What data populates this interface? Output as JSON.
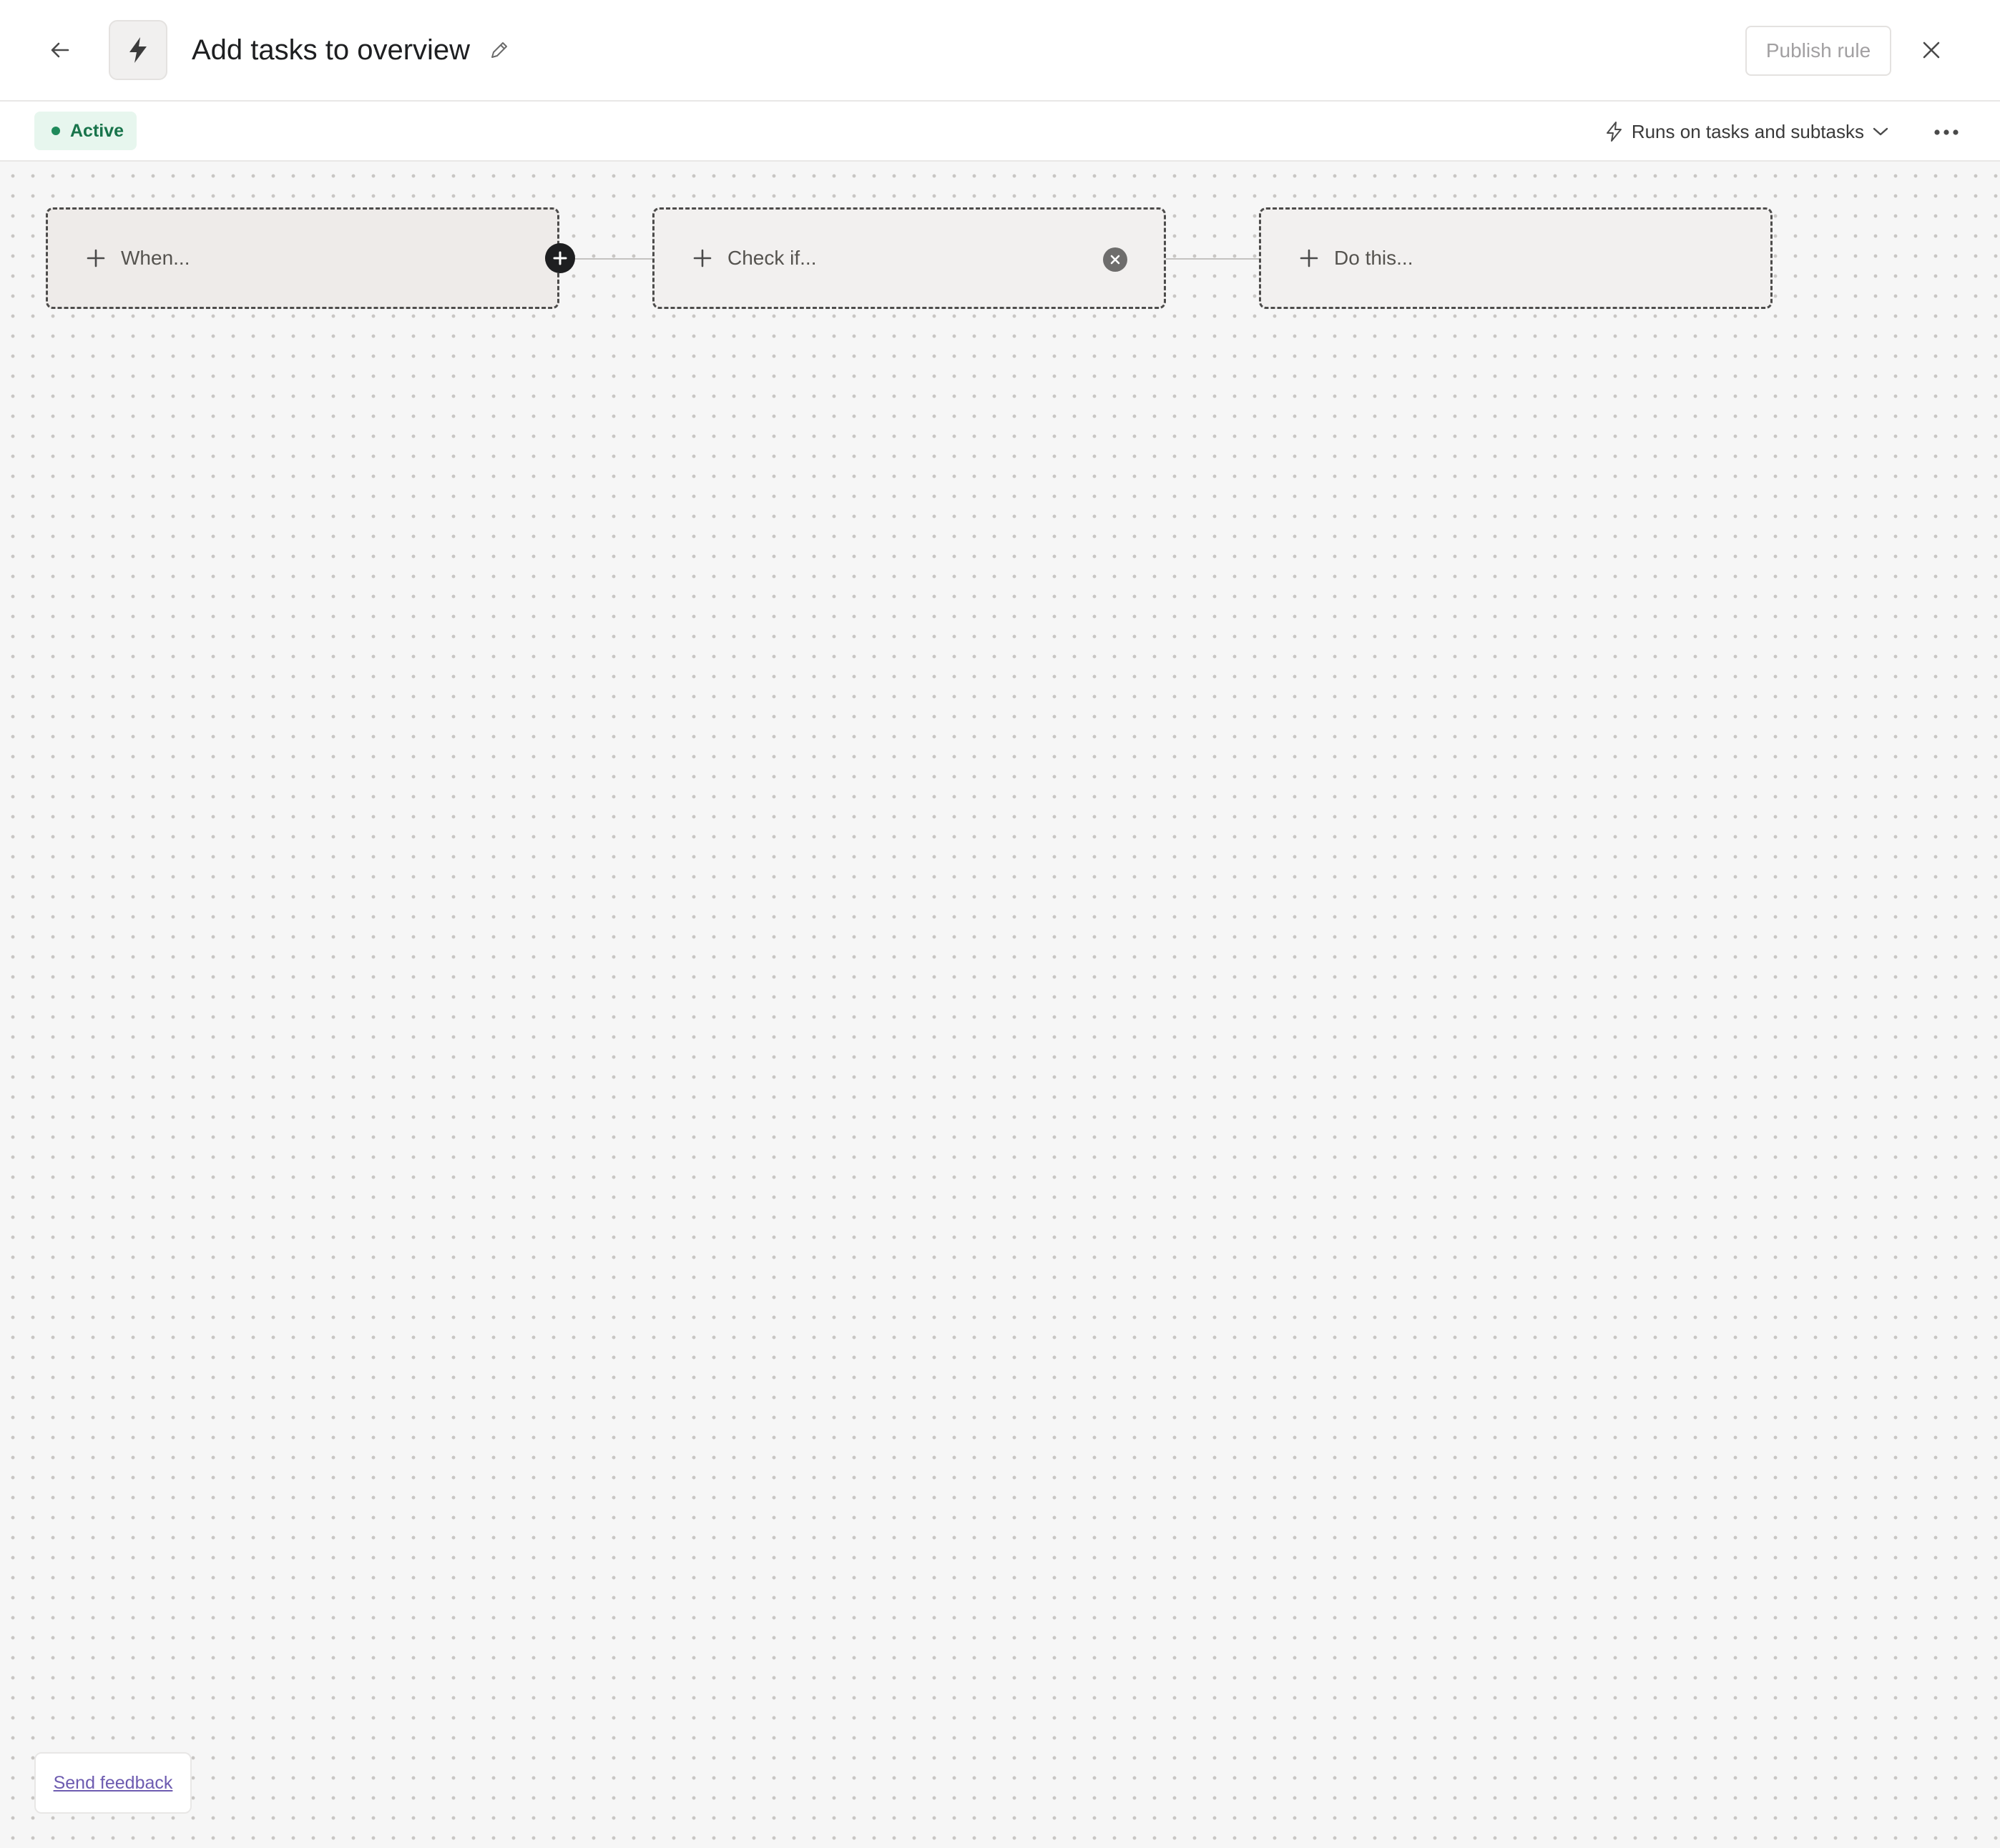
{
  "header": {
    "title": "Add tasks to overview",
    "publish_label": "Publish rule",
    "icons": {
      "back": "arrow-left-icon",
      "rule": "lightning-bolt-icon",
      "edit": "pencil-icon",
      "close": "close-icon"
    }
  },
  "subheader": {
    "status_label": "Active",
    "runs_on_label": "Runs on tasks and subtasks",
    "icons": {
      "runs_on": "lightning-outline-icon",
      "dropdown": "chevron-down-icon",
      "more": "more-horizontal-icon"
    }
  },
  "workflow": {
    "steps": [
      {
        "label": "When..."
      },
      {
        "label": "Check if..."
      },
      {
        "label": "Do this..."
      }
    ],
    "icons": {
      "add_step": "plus-circle-icon",
      "remove_step": "close-circle-icon",
      "node_plus": "plus-icon"
    }
  },
  "footer": {
    "feedback_label": "Send feedback"
  },
  "colors": {
    "status_green": "#18744b",
    "status_bg": "#e7f6ee",
    "canvas_bg": "#f6f6f6",
    "link": "#6d5bb0"
  }
}
